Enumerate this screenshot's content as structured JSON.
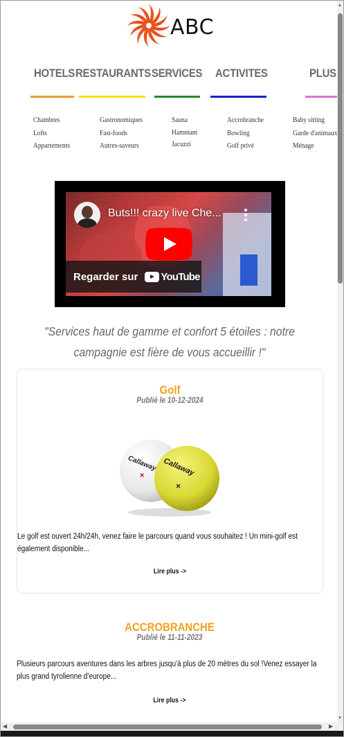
{
  "header": {
    "brand": "ABC"
  },
  "nav": {
    "items": [
      {
        "label": "HOTELS",
        "color": "#f09a30"
      },
      {
        "label": "RESTAURANTS",
        "color": "#f5e010"
      },
      {
        "label": "SERVICES",
        "color": "#1f8a2a"
      },
      {
        "label": "ACTIVITES",
        "color": "#1020c8"
      },
      {
        "label": "PLUS",
        "color": "#e070d0"
      }
    ],
    "submenus": [
      [
        "Chambres",
        "Lofts",
        "Appartements"
      ],
      [
        "Gastronomiques",
        "Fast-foods",
        "Autres-saveurs"
      ],
      [
        "Sauna",
        "Hammam",
        "Jacuzzi"
      ],
      [
        "Accrobranche",
        "Bowling",
        "Golf privé"
      ],
      [
        "Baby sitting",
        "Garde d'animaux",
        "Ménage"
      ]
    ]
  },
  "video": {
    "title": "Buts!!! crazy live Che...",
    "watch_label": "Regarder sur",
    "platform": "YouTube"
  },
  "quote": "\"Services haut de gamme et confort 5 étoiles : notre campagnie est fière de vous accueillir !\"",
  "articles": [
    {
      "title": "Golf",
      "date": "Publié le 10-12-2024",
      "text": "Le golf est ouvert 24h/24h, venez faire le parcours quand vous souhaitez ! Un mini-golf est également disponible...",
      "more": "Lire plus ->",
      "image": "golf-balls-image",
      "image_brand": "Callaway"
    },
    {
      "title": "ACCROBRANCHE",
      "date": "Publié le 11-11-2023",
      "text": "Plusieurs parcours aventures dans les arbres jusqu'à plus de 20 mètres du sol !Venez essayer la plus grand tyrolienne d'europe...",
      "more": "Lire plus ->"
    }
  ],
  "colors": {
    "accent": "#f0a020",
    "logo": "#e8531e"
  }
}
